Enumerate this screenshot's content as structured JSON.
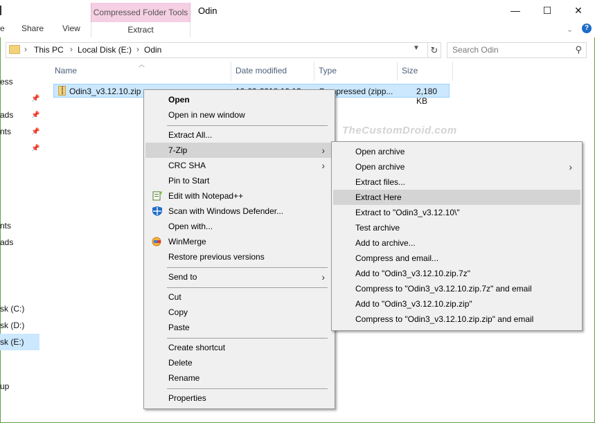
{
  "window": {
    "title": "Odin",
    "minimize_glyph": "—",
    "maximize_glyph": "☐",
    "close_glyph": "✕"
  },
  "ribbon": {
    "tabs": [
      "Share",
      "View"
    ],
    "context_group": "Compressed Folder Tools",
    "context_tab": "Extract",
    "expand_icon": "chevron-down-icon",
    "help_label": "?"
  },
  "address": {
    "crumbs": [
      "This PC",
      "Local Disk (E:)",
      "Odin"
    ],
    "separator": "›",
    "search_placeholder": "Search Odin"
  },
  "nav": {
    "items": [
      "ess",
      "ads",
      "nts",
      "nts",
      "ads",
      "sk (C:)",
      "sk (D:)",
      "sk (E:)",
      "up"
    ],
    "selected": "sk (E:)"
  },
  "columns": [
    "Name",
    "Date modified",
    "Type",
    "Size"
  ],
  "file": {
    "name": "Odin3_v3.12.10.zip",
    "date": "10-09-2018 10:13",
    "type": "Compressed (zipp...",
    "size": "2,180 KB"
  },
  "watermark": "TheCustomDroid.com",
  "context_menu": {
    "groups": [
      [
        "Open",
        "Open in new window"
      ],
      [
        "Extract All...",
        "7-Zip",
        "CRC SHA",
        "Pin to Start",
        "Edit with Notepad++",
        "Scan with Windows Defender...",
        "Open with...",
        "WinMerge",
        "Restore previous versions"
      ],
      [
        "Send to"
      ],
      [
        "Cut",
        "Copy",
        "Paste"
      ],
      [
        "Create shortcut",
        "Delete",
        "Rename"
      ],
      [
        "Properties"
      ]
    ],
    "highlighted": "7-Zip"
  },
  "submenu_7zip": {
    "items": [
      "Open archive",
      "Open archive",
      "Extract files...",
      "Extract Here",
      "Extract to \"Odin3_v3.12.10\\\"",
      "Test archive",
      "Add to archive...",
      "Compress and email...",
      "Add to \"Odin3_v3.12.10.zip.7z\"",
      "Compress to \"Odin3_v3.12.10.zip.7z\" and email",
      "Add to \"Odin3_v3.12.10.zip.zip\"",
      "Compress to \"Odin3_v3.12.10.zip.zip\" and email"
    ],
    "highlighted": "Extract Here"
  },
  "colors": {
    "context_header_bg": "#f5cfe3",
    "selection_bg": "#cce8ff",
    "menu_bg": "#f0f0f0",
    "menu_highlight": "#d4d4d4"
  }
}
